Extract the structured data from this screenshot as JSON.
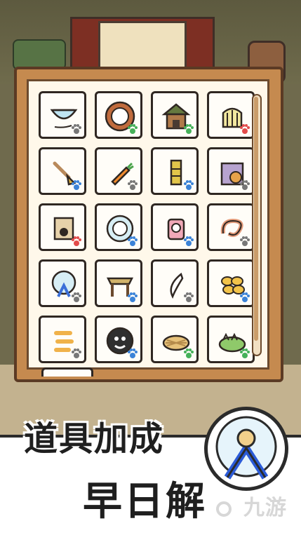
{
  "banner": {
    "title": "道具加成",
    "subtitle": "早日解",
    "badge_icon": "hamster-wheel-icon"
  },
  "watermark": {
    "text": "九游"
  },
  "inventory": {
    "items": [
      {
        "name": "bowl",
        "icon": "bowl-icon",
        "paw_color": "#777777"
      },
      {
        "name": "plate",
        "icon": "plate-icon",
        "paw_color": "#45b15a"
      },
      {
        "name": "wooden-house",
        "icon": "house-icon",
        "paw_color": "#45b15a"
      },
      {
        "name": "bird-cage",
        "icon": "cage-icon",
        "paw_color": "#e24b4b"
      },
      {
        "name": "shovel",
        "icon": "shovel-icon",
        "paw_color": "#3b83d8"
      },
      {
        "name": "carrot",
        "icon": "carrot-icon",
        "paw_color": "#777777"
      },
      {
        "name": "bamboo",
        "icon": "bamboo-icon",
        "paw_color": "#3b83d8"
      },
      {
        "name": "cat-in-bag",
        "icon": "bag-cat-icon",
        "paw_color": "#777777"
      },
      {
        "name": "scroll",
        "icon": "scroll-icon",
        "paw_color": "#e24b4b"
      },
      {
        "name": "sheep-plate",
        "icon": "sheep-icon",
        "paw_color": "#3b83d8"
      },
      {
        "name": "gacha",
        "icon": "gacha-icon",
        "paw_color": "#3b83d8"
      },
      {
        "name": "rope",
        "icon": "rope-icon",
        "paw_color": "#777777"
      },
      {
        "name": "hamster-wheel",
        "icon": "wheel-icon",
        "paw_color": "#777777"
      },
      {
        "name": "straw-table",
        "icon": "table-icon",
        "paw_color": "#3b83d8"
      },
      {
        "name": "tooth",
        "icon": "tooth-icon",
        "paw_color": "#777777"
      },
      {
        "name": "snacks",
        "icon": "snack-icon",
        "paw_color": "#3b83d8"
      },
      {
        "name": "shrimp",
        "icon": "shrimp-icon",
        "paw_color": "#777777"
      },
      {
        "name": "ghost-plate",
        "icon": "ghost-icon",
        "paw_color": "#3b83d8"
      },
      {
        "name": "straw-nest",
        "icon": "nest-icon",
        "paw_color": "#45b15a"
      },
      {
        "name": "grass",
        "icon": "grass-icon",
        "paw_color": "#45b15a"
      }
    ]
  }
}
